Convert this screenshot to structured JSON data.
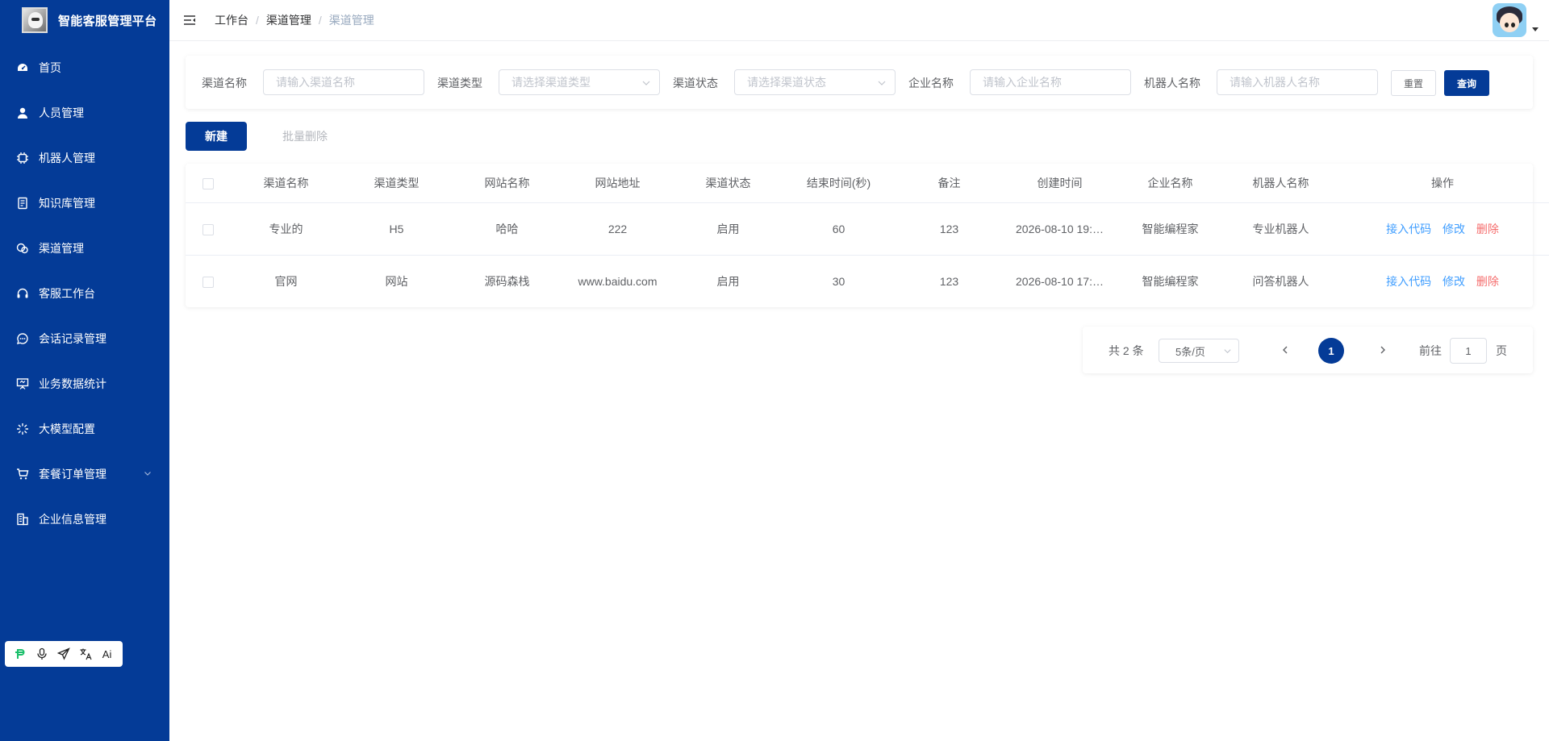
{
  "sidebar": {
    "brand_title": "智能客服管理平台",
    "items": [
      {
        "label": "首页",
        "icon": "dashboard-icon"
      },
      {
        "label": "人员管理",
        "icon": "user-icon"
      },
      {
        "label": "机器人管理",
        "icon": "chip-icon"
      },
      {
        "label": "知识库管理",
        "icon": "book-icon"
      },
      {
        "label": "渠道管理",
        "icon": "channel-icon"
      },
      {
        "label": "客服工作台",
        "icon": "headset-icon"
      },
      {
        "label": "会话记录管理",
        "icon": "chat-icon"
      },
      {
        "label": "业务数据统计",
        "icon": "presentation-icon"
      },
      {
        "label": "大模型配置",
        "icon": "sparkle-icon"
      },
      {
        "label": "套餐订单管理",
        "icon": "cart-icon"
      },
      {
        "label": "企业信息管理",
        "icon": "building-icon"
      }
    ],
    "tools": [
      "pinyin-p-icon",
      "microphone-icon",
      "send-icon",
      "translate-icon",
      "ai-text-icon"
    ],
    "tool_ai_text": "Ai"
  },
  "header": {
    "breadcrumb": [
      "工作台",
      "渠道管理",
      "渠道管理"
    ],
    "separator": "/"
  },
  "search": {
    "channel_name_label": "渠道名称",
    "channel_name_placeholder": "请输入渠道名称",
    "channel_type_label": "渠道类型",
    "channel_type_placeholder": "请选择渠道类型",
    "channel_status_label": "渠道状态",
    "channel_status_placeholder": "请选择渠道状态",
    "company_label": "企业名称",
    "company_placeholder": "请输入企业名称",
    "robot_label": "机器人名称",
    "robot_placeholder": "请输入机器人名称",
    "reset_label": "重置",
    "query_label": "查询"
  },
  "actions": {
    "new_label": "新建",
    "batch_delete_label": "批量删除"
  },
  "table": {
    "headers": [
      "渠道名称",
      "渠道类型",
      "网站名称",
      "网站地址",
      "渠道状态",
      "结束时间(秒)",
      "备注",
      "创建时间",
      "企业名称",
      "机器人名称",
      "操作"
    ],
    "rows": [
      {
        "name": "专业的",
        "type": "H5",
        "site": "哈哈",
        "url": "222",
        "status": "启用",
        "end": "60",
        "remark": "123",
        "created": "2026-08-10 19:…",
        "company": "智能编程家",
        "robot": "专业机器人"
      },
      {
        "name": "官网",
        "type": "网站",
        "site": "源码森栈",
        "url": "www.baidu.com",
        "status": "启用",
        "end": "30",
        "remark": "123",
        "created": "2026-08-10 17:…",
        "company": "智能编程家",
        "robot": "问答机器人"
      }
    ],
    "op_code": "接入代码",
    "op_edit": "修改",
    "op_delete": "删除"
  },
  "pagination": {
    "total_text": "共 2 条",
    "page_size": "5条/页",
    "current_page": "1",
    "goto_label": "前往",
    "goto_value": "1",
    "page_unit": "页"
  },
  "colors": {
    "primary": "#043b97",
    "link": "#409eff",
    "danger": "#f56c6c"
  }
}
